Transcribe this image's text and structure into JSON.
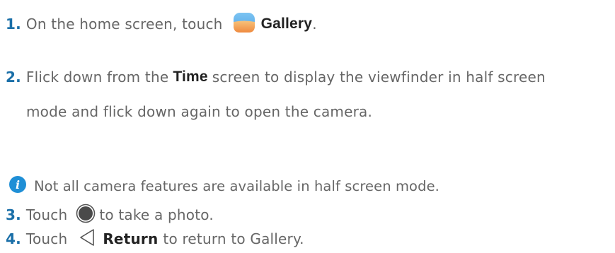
{
  "steps": [
    {
      "number": "1.",
      "text_before": "On the home screen, touch",
      "icon": "gallery-icon",
      "bold": "Gallery",
      "text_after": "."
    },
    {
      "number": "2.",
      "text_before": "Flick down from the",
      "bold": "Time",
      "line1_after": "screen to display the viewfinder in half screen",
      "line2": "mode and flick down again to open the camera."
    },
    {
      "number": "3.",
      "text_before": "Touch",
      "icon": "shutter-icon",
      "text_after": "to take a photo."
    },
    {
      "number": "4.",
      "text_before": "Touch",
      "icon": "back-triangle-icon",
      "bold": "Return",
      "text_after": "to return to Gallery."
    }
  ],
  "note": {
    "icon": "info-icon",
    "text": "Not all camera features are available in half screen mode."
  },
  "colors": {
    "step_number": "#1a6fa8",
    "body_text": "#666666",
    "bold_text": "#222222",
    "info_icon": "#1f8fd6",
    "shutter": "#4a4a4a"
  }
}
